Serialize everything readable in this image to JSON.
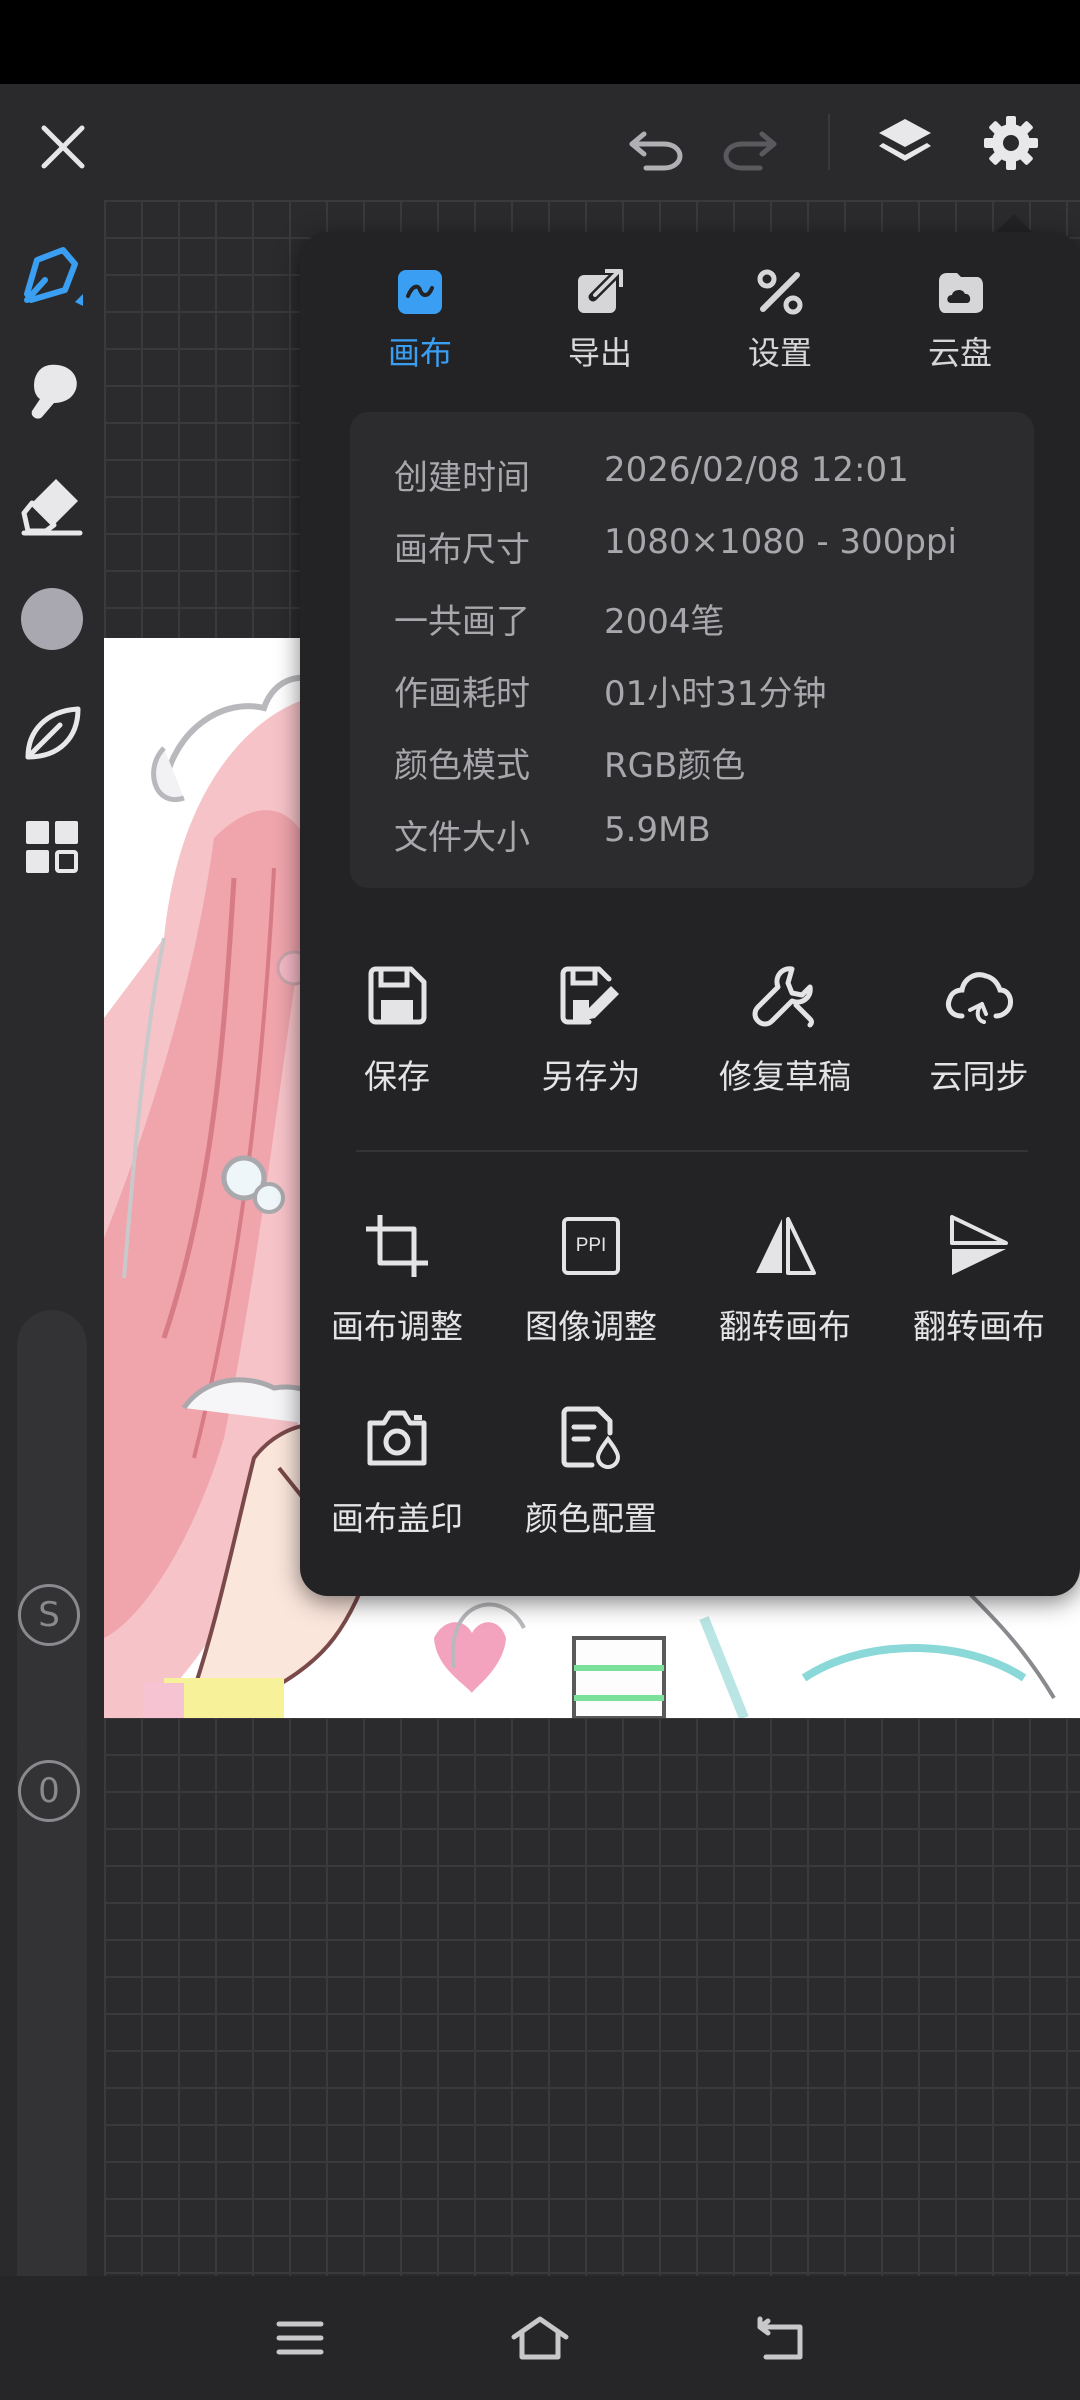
{
  "popup": {
    "tabs": [
      {
        "label": "画布",
        "icon": "canvas-icon",
        "active": true
      },
      {
        "label": "导出",
        "icon": "export-icon",
        "active": false
      },
      {
        "label": "设置",
        "icon": "settings-tools-icon",
        "active": false
      },
      {
        "label": "云盘",
        "icon": "cloud-drive-icon",
        "active": false
      }
    ],
    "info": [
      {
        "key": "创建时间",
        "value": "2026/02/08 12:01"
      },
      {
        "key": "画布尺寸",
        "value": "1080×1080 - 300ppi"
      },
      {
        "key": "一共画了",
        "value": "2004笔"
      },
      {
        "key": "作画耗时",
        "value": "01小时31分钟"
      },
      {
        "key": "颜色模式",
        "value": "RGB颜色"
      },
      {
        "key": "文件大小",
        "value": "5.9MB"
      }
    ],
    "actions_row1": [
      {
        "label": "保存",
        "icon": "save-icon"
      },
      {
        "label": "另存为",
        "icon": "save-as-icon"
      },
      {
        "label": "修复草稿",
        "icon": "wrench-icon"
      },
      {
        "label": "云同步",
        "icon": "cloud-sync-icon"
      }
    ],
    "actions_row2": [
      {
        "label": "画布调整",
        "icon": "crop-icon"
      },
      {
        "label": "图像调整",
        "icon": "ppi-icon",
        "icon_text": "PPI"
      },
      {
        "label": "翻转画布",
        "icon": "flip-horizontal-icon"
      },
      {
        "label": "翻转画布",
        "icon": "flip-vertical-icon"
      }
    ],
    "actions_row3": [
      {
        "label": "画布盖印",
        "icon": "camera-icon"
      },
      {
        "label": "颜色配置",
        "icon": "color-profile-icon"
      }
    ]
  },
  "sliders": {
    "size_label": "S",
    "opacity_label": "0"
  },
  "colors": {
    "accent": "#3a9ff2",
    "popup_bg": "#232325",
    "current_color": "#a9a8b0"
  }
}
